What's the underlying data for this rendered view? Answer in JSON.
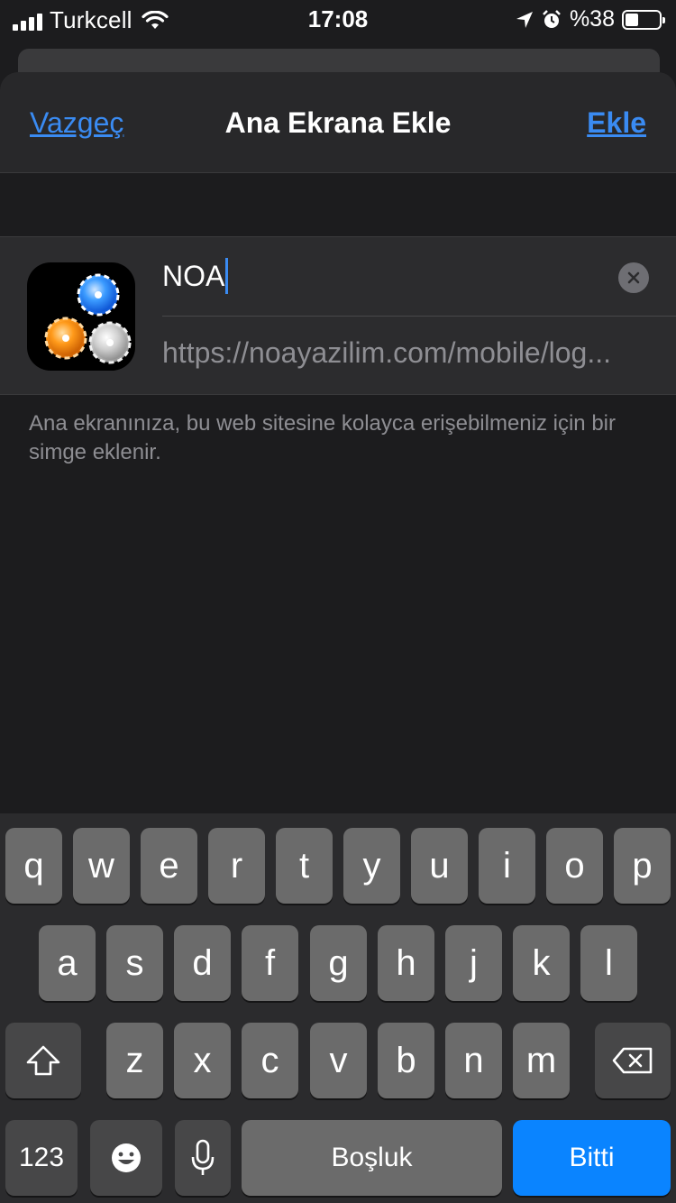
{
  "status_bar": {
    "carrier": "Turkcell",
    "time": "17:08",
    "battery_text": "%38",
    "battery_level": 0.38
  },
  "nav": {
    "cancel_label": "Vazgeç",
    "title": "Ana Ekrana Ekle",
    "add_label": "Ekle"
  },
  "form": {
    "name_value": "NOA",
    "url": "https://noayazilim.com/mobile/log..."
  },
  "description": "Ana ekranınıza, bu web sitesine kolayca erişebilmeniz için bir simge eklenir.",
  "keyboard": {
    "row1": [
      "q",
      "w",
      "e",
      "r",
      "t",
      "y",
      "u",
      "i",
      "o",
      "p"
    ],
    "row2": [
      "a",
      "s",
      "d",
      "f",
      "g",
      "h",
      "j",
      "k",
      "l"
    ],
    "row3": [
      "z",
      "x",
      "c",
      "v",
      "b",
      "n",
      "m"
    ],
    "numbers_label": "123",
    "space_label": "Boşluk",
    "done_label": "Bitti"
  },
  "colors": {
    "accent": "#3a8bf2",
    "done_button": "#0a84ff"
  },
  "icons": [
    "signal-icon",
    "wifi-icon",
    "location-icon",
    "alarm-icon",
    "battery-icon",
    "clear-icon",
    "shift-icon",
    "backspace-icon",
    "emoji-icon",
    "microphone-icon",
    "app-gear-icon"
  ]
}
